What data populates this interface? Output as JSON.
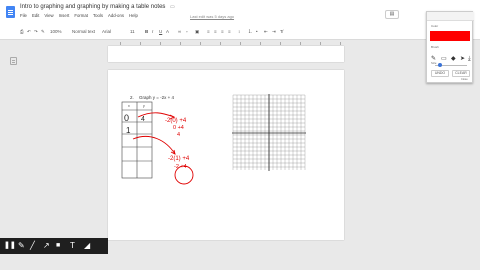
{
  "header": {
    "title": "Intro to graphing and graphing by making a table notes",
    "last_edit": "Last edit was 5 days ago",
    "menu": [
      "File",
      "Edit",
      "View",
      "Insert",
      "Format",
      "Tools",
      "Add-ons",
      "Help"
    ],
    "star_icon": "star-icon",
    "folder_icon": "folder-icon"
  },
  "toolbar": {
    "zoom": "100%",
    "style": "Normal text",
    "font": "Arial",
    "size": "11"
  },
  "document": {
    "question_number": "2.",
    "question_text": "Graph   y = -2x + 4",
    "table_header_x": "x",
    "table_header_y": "y",
    "handwritten": {
      "row1_x": "0",
      "row1_y": "4",
      "row2_x": "1",
      "work1_line1": "-2(0) +4",
      "work1_line2": "0 +4",
      "work1_line3": "4",
      "work2_line1": "-2(1) +4",
      "work2_line2": "-2 +4"
    }
  },
  "annotation_panel": {
    "color_label": "Color",
    "brush_label": "Brush",
    "size_label": "Size",
    "undo_label": "UNDO",
    "clear_label": "CLEAR",
    "close_label": "Close",
    "selected_color": "#ff0000"
  },
  "bottom_toolbar": {
    "icons": [
      "pause-icon",
      "pen-icon",
      "line-icon",
      "arrow-icon",
      "camera-icon",
      "text-icon",
      "eraser-icon"
    ]
  }
}
